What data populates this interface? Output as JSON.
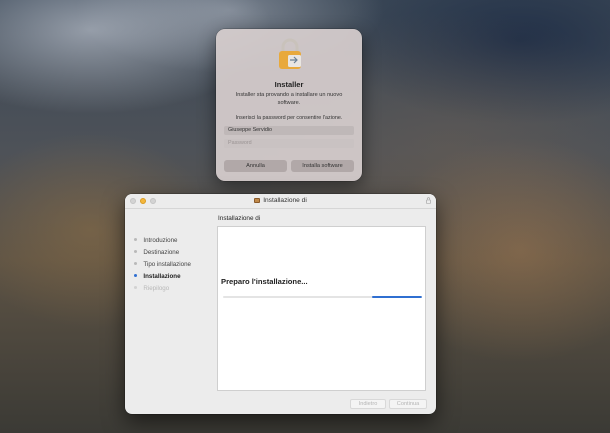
{
  "auth_dialog": {
    "title": "Installer",
    "message": "Installer sta provando a installare un nuovo software.",
    "prompt": "Inserisci la password per consentire l'azione.",
    "username": "Giuseppe Servidio",
    "password_placeholder": "Password",
    "cancel_label": "Annulla",
    "confirm_label": "Installa software",
    "icon": "lock-icon"
  },
  "installer": {
    "window_title": "Installazione di",
    "section_title": "Installazione di",
    "steps": [
      {
        "label": "Introduzione",
        "state": "done"
      },
      {
        "label": "Destinazione",
        "state": "done"
      },
      {
        "label": "Tipo installazione",
        "state": "done"
      },
      {
        "label": "Installazione",
        "state": "active"
      },
      {
        "label": "Riepilogo",
        "state": "future"
      }
    ],
    "status_text": "Preparo l'installazione...",
    "progress": {
      "indeterminate": true,
      "segment_start_fraction": 0.75,
      "segment_end_fraction": 1.0
    },
    "back_label": "Indietro",
    "continue_label": "Continua",
    "accent_color": "#2f6fd1"
  }
}
